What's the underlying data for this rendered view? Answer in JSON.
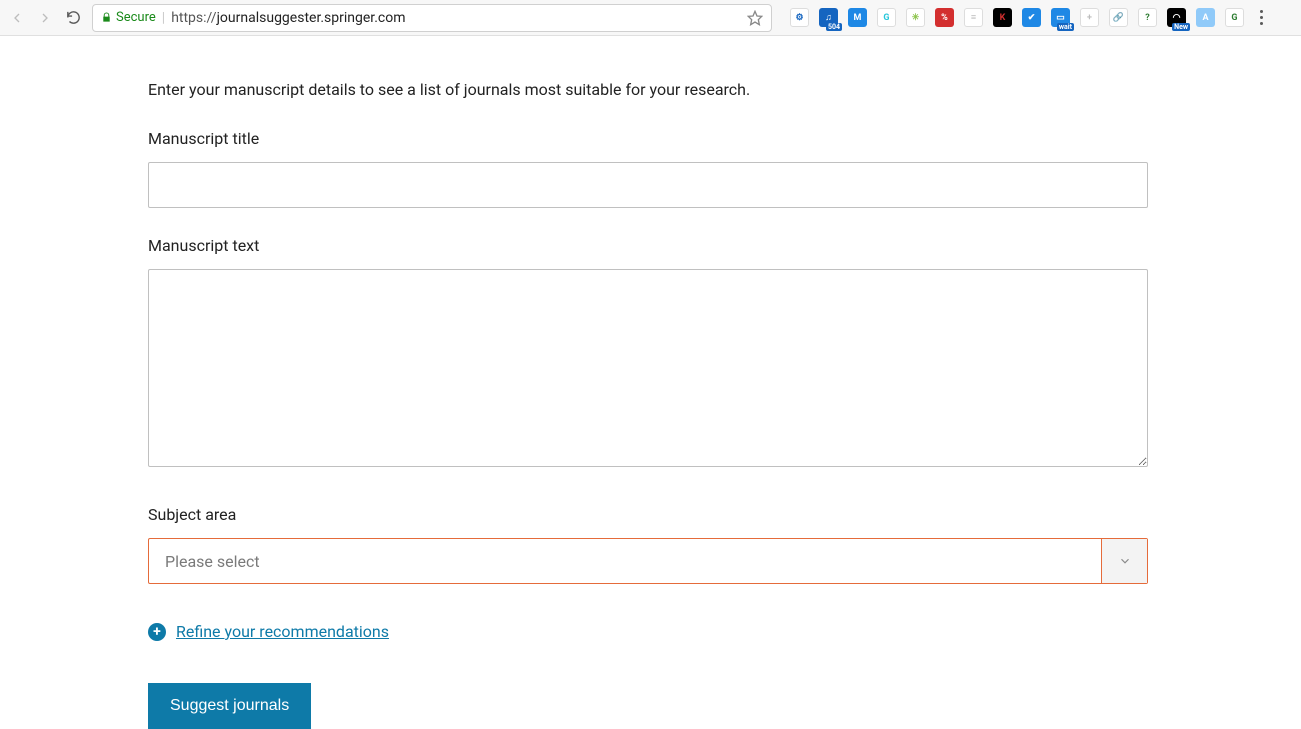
{
  "browser": {
    "secure_label": "Secure",
    "url_scheme": "https",
    "url_host": "journalsuggester.springer.com",
    "url_path": "",
    "extensions": [
      {
        "name": "ext-1",
        "bg": "#ffffff",
        "fg": "#1565c0",
        "txt": "⚙"
      },
      {
        "name": "ext-2",
        "bg": "#1565c0",
        "fg": "#ffffff",
        "txt": "♫",
        "badge": "504"
      },
      {
        "name": "ext-m",
        "bg": "#1e88e5",
        "fg": "#ffffff",
        "txt": "M"
      },
      {
        "name": "ext-g",
        "bg": "#ffffff",
        "fg": "#26c6da",
        "txt": "G"
      },
      {
        "name": "ext-bug",
        "bg": "#ffffff",
        "fg": "#8bc34a",
        "txt": "✳"
      },
      {
        "name": "ext-pct",
        "bg": "#d32f2f",
        "fg": "#ffffff",
        "txt": "%"
      },
      {
        "name": "ext-stack",
        "bg": "#ffffff",
        "fg": "#bdbdbd",
        "txt": "≡"
      },
      {
        "name": "ext-k",
        "bg": "#000000",
        "fg": "#d32f2f",
        "txt": "K"
      },
      {
        "name": "ext-check",
        "bg": "#1e88e5",
        "fg": "#ffffff",
        "txt": "✔"
      },
      {
        "name": "ext-wait",
        "bg": "#1e88e5",
        "fg": "#ffffff",
        "txt": "▭",
        "badge": "wait"
      },
      {
        "name": "ext-plus",
        "bg": "#ffffff",
        "fg": "#bdbdbd",
        "txt": "+"
      },
      {
        "name": "ext-link",
        "bg": "#ffffff",
        "fg": "#42a5f5",
        "txt": "🔗"
      },
      {
        "name": "ext-q",
        "bg": "#ffffff",
        "fg": "#2e7d32",
        "txt": "?"
      },
      {
        "name": "ext-new",
        "bg": "#000000",
        "fg": "#ffffff",
        "txt": "◠",
        "badge": "New"
      },
      {
        "name": "ext-a",
        "bg": "#90caf9",
        "fg": "#ffffff",
        "txt": "A"
      },
      {
        "name": "ext-grammarly",
        "bg": "#ffffff",
        "fg": "#2e7d32",
        "txt": "G"
      }
    ]
  },
  "page": {
    "intro": "Enter your manuscript details to see a list of journals most suitable for your research.",
    "title_label": "Manuscript title",
    "title_value": "",
    "text_label": "Manuscript text",
    "text_value": "",
    "subject_label": "Subject area",
    "subject_placeholder": "Please select",
    "refine_label": "Refine your recommendations",
    "suggest_button": "Suggest journals"
  }
}
